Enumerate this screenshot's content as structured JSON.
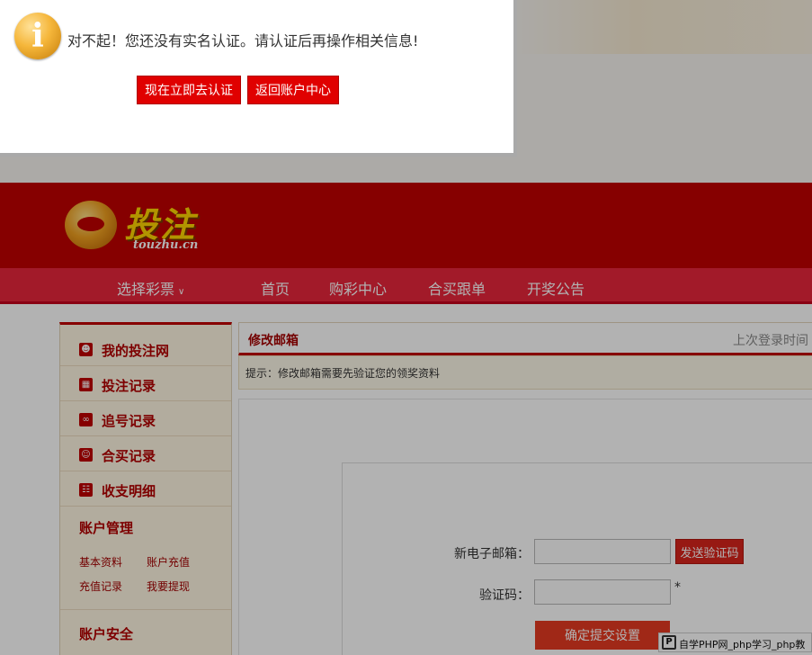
{
  "dialog": {
    "icon": "info-icon",
    "message": "对不起！您还没有实名认证。请认证后再操作相关信息!",
    "verify_now_label": "现在立即去认证",
    "back_to_account_label": "返回账户中心"
  },
  "header": {
    "logo_text": "投注",
    "logo_domain": "touzhu.cn"
  },
  "nav": {
    "select_lottery": "选择彩票",
    "items": [
      "首页",
      "购彩中心",
      "合买跟单",
      "开奖公告"
    ]
  },
  "sidebar": {
    "items": [
      {
        "label": "我的投注网",
        "icon": "user-icon"
      },
      {
        "label": "投注记录",
        "icon": "calendar-icon"
      },
      {
        "label": "追号记录",
        "icon": "chase-icon"
      },
      {
        "label": "合买记录",
        "icon": "group-buy-icon"
      },
      {
        "label": "收支明细",
        "icon": "ledger-icon"
      }
    ],
    "account_manage": {
      "title": "账户管理",
      "links": [
        "基本资料",
        "账户充值",
        "充值记录",
        "我要提现"
      ]
    },
    "account_security": {
      "title": "账户安全"
    }
  },
  "content": {
    "title": "修改邮箱",
    "last_login_label": "上次登录时间",
    "tip": "提示：修改邮箱需要先验证您的领奖资料",
    "email_label": "新电子邮箱：",
    "email_value": "",
    "send_code_label": "发送验证码",
    "code_label": "验证码：",
    "code_value": "",
    "required_mark": "*",
    "submit_label": "确定提交设置"
  },
  "watermark": {
    "text": "自学PHP网_php学习_php教"
  },
  "colors": {
    "brand_red": "#c00000",
    "nav_red": "#e8263c",
    "button_red": "#e00000"
  }
}
